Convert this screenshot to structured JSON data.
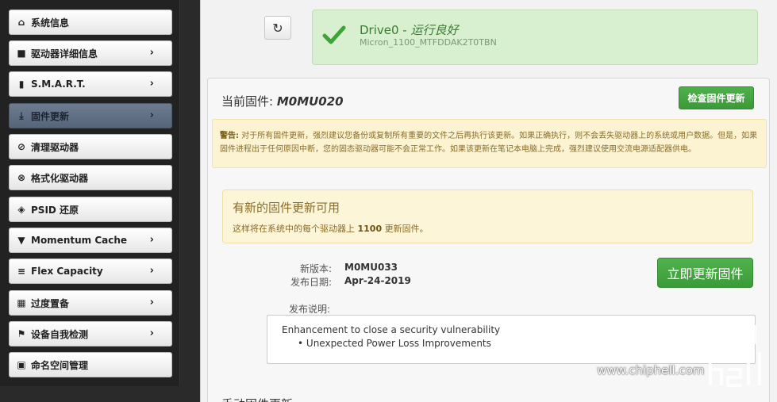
{
  "sidebar": {
    "items": [
      {
        "label": "系统信息",
        "icon": "home-icon",
        "has_chevron": false
      },
      {
        "label": "驱动器详细信息",
        "icon": "drive-icon",
        "has_chevron": true
      },
      {
        "label": "S.M.A.R.T.",
        "icon": "bar-chart-icon",
        "has_chevron": true
      },
      {
        "label": "固件更新",
        "icon": "download-icon",
        "has_chevron": true,
        "active": true
      },
      {
        "label": "清理驱动器",
        "icon": "ban-icon",
        "has_chevron": false
      },
      {
        "label": "格式化驱动器",
        "icon": "times-circle-icon",
        "has_chevron": false
      },
      {
        "label": "PSID 还原",
        "icon": "eraser-icon",
        "has_chevron": false
      },
      {
        "label": "Momentum Cache",
        "icon": "filter-icon",
        "has_chevron": true
      },
      {
        "label": "Flex Capacity",
        "icon": "list-icon",
        "has_chevron": true
      },
      {
        "label": "过度置备",
        "icon": "grid-icon",
        "has_chevron": true
      },
      {
        "label": "设备自我检测",
        "icon": "flag-icon",
        "has_chevron": true
      },
      {
        "label": "命名空间管理",
        "icon": "briefcase-icon",
        "has_chevron": false
      }
    ]
  },
  "status": {
    "drive": "Drive0 - ",
    "health": "运行良好",
    "model": "Micron_1100_MTFDDAK2T0TBN",
    "color": "#3a7a34"
  },
  "firmware": {
    "current_label": "当前固件: ",
    "current_version": "M0MU020",
    "check_button": "检查固件更新",
    "warning_label": "警告:",
    "warning_text": " 对于所有固件更新，强烈建议您备份或复制所有重要的文件之后再执行该更新。如果正确执行，则不会丢失驱动器上的系统或用户数据。但是，如果固件进程出于任何原因中断，您的固态驱动器可能不会正常工作。如果该更新在笔记本电脑上完成，强烈建议使用交流电源适配器供电。",
    "available_title": "有新的固件更新可用",
    "available_prefix": "这样将在系统中的每个驱动器上 ",
    "available_version": "1100",
    "available_suffix": " 更新固件。",
    "new_version_label": "新版本:",
    "new_version": "M0MU033",
    "release_date_label": "发布日期:",
    "release_date": "Apr-24-2019",
    "update_button": "立即更新固件",
    "notes_label": "发布说明:",
    "notes_line": "Enhancement to close a security vulnerability",
    "notes_bullet": "Unexpected Power Loss Improvements",
    "manual_title": "手动固件更新"
  },
  "watermark": {
    "url": "www.chiphell.com"
  }
}
